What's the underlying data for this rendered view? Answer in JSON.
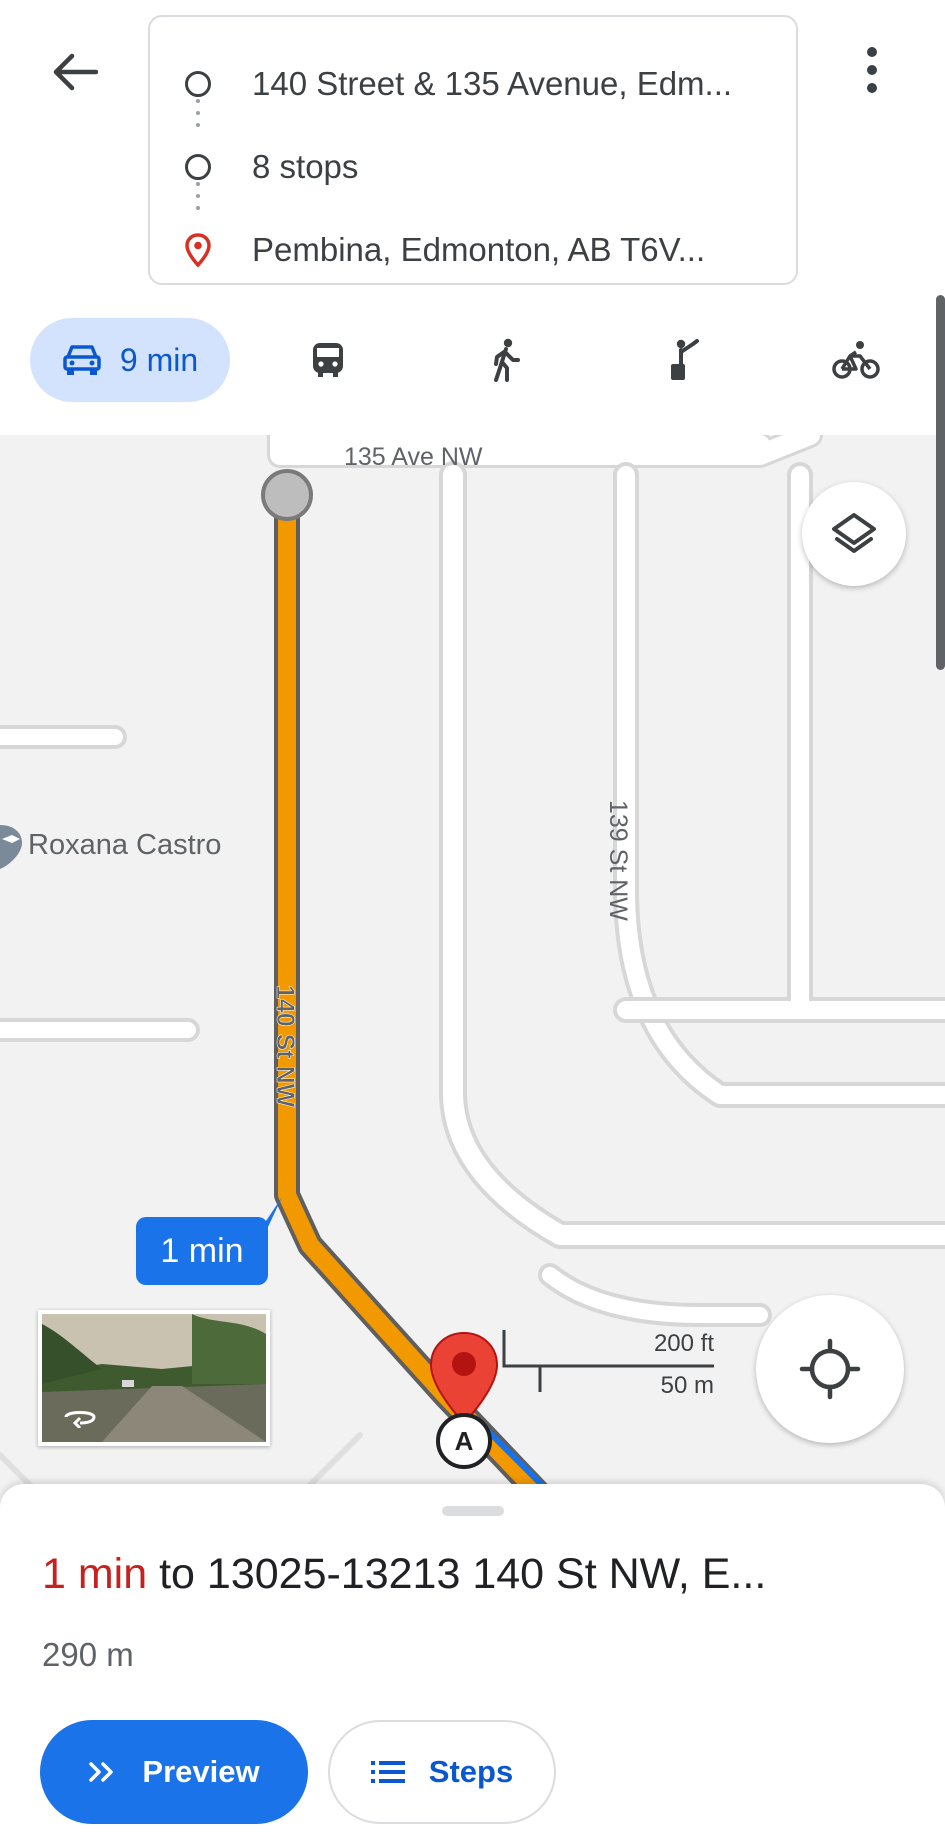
{
  "route": {
    "origin": "140 Street & 135 Avenue, Edm...",
    "stops": "8 stops",
    "destination": "Pembina, Edmonton, AB T6V..."
  },
  "modes": {
    "active_label": "9 min",
    "items": [
      {
        "name": "drive",
        "icon": "car-icon",
        "selected": true
      },
      {
        "name": "transit",
        "icon": "transit-icon",
        "selected": false
      },
      {
        "name": "walk",
        "icon": "walk-icon",
        "selected": false
      },
      {
        "name": "ride",
        "icon": "ride-hail-icon",
        "selected": false
      },
      {
        "name": "cycle",
        "icon": "bicycle-icon",
        "selected": false
      }
    ]
  },
  "map": {
    "streets": {
      "ave135": "135 Ave NW",
      "st139": "139 St NW",
      "st140": "140 St NW"
    },
    "poi": "Roxana Castro",
    "time_bubble": "1 min",
    "marker_letter": "A",
    "scale": {
      "imperial": "200 ft",
      "metric": "50 m"
    },
    "route_color": "#f29900",
    "accent": "#1a73e8"
  },
  "sheet": {
    "duration": "1 min",
    "destination_text": "to 13025-13213 140 St NW, E...",
    "distance": "290 m",
    "preview_label": "Preview",
    "steps_label": "Steps"
  }
}
